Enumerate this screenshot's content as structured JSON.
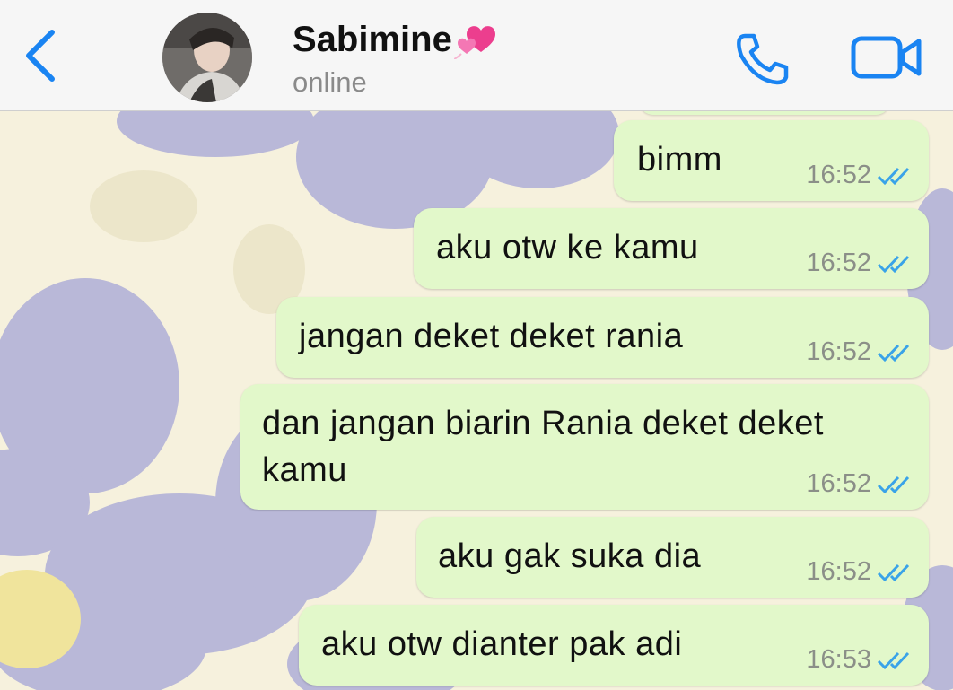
{
  "header": {
    "contact_name": "Sabimine",
    "contact_status": "online"
  },
  "colors": {
    "accent": "#1a84f2",
    "bubble_outgoing": "#e2f8ca",
    "tick_read": "#3aa3e8",
    "wallpaper_base": "#f6f1dd",
    "wallpaper_petal": "#b9b8d8",
    "wallpaper_center": "#f0e49c"
  },
  "icons": {
    "back": "chevron-left-icon",
    "call": "phone-icon",
    "video": "video-camera-icon",
    "read_receipt": "double-check-icon",
    "emoji": "two-hearts-emoji"
  },
  "messages": [
    {
      "text": "bimm",
      "time": "16:52",
      "status": "read"
    },
    {
      "text": "aku otw ke kamu",
      "time": "16:52",
      "status": "read"
    },
    {
      "text": "jangan deket deket rania",
      "time": "16:52",
      "status": "read"
    },
    {
      "text": "dan jangan biarin Rania deket deket kamu",
      "time": "16:52",
      "status": "read"
    },
    {
      "text": "aku gak suka dia",
      "time": "16:52",
      "status": "read"
    },
    {
      "text": "aku otw dianter pak adi",
      "time": "16:53",
      "status": "read"
    }
  ]
}
